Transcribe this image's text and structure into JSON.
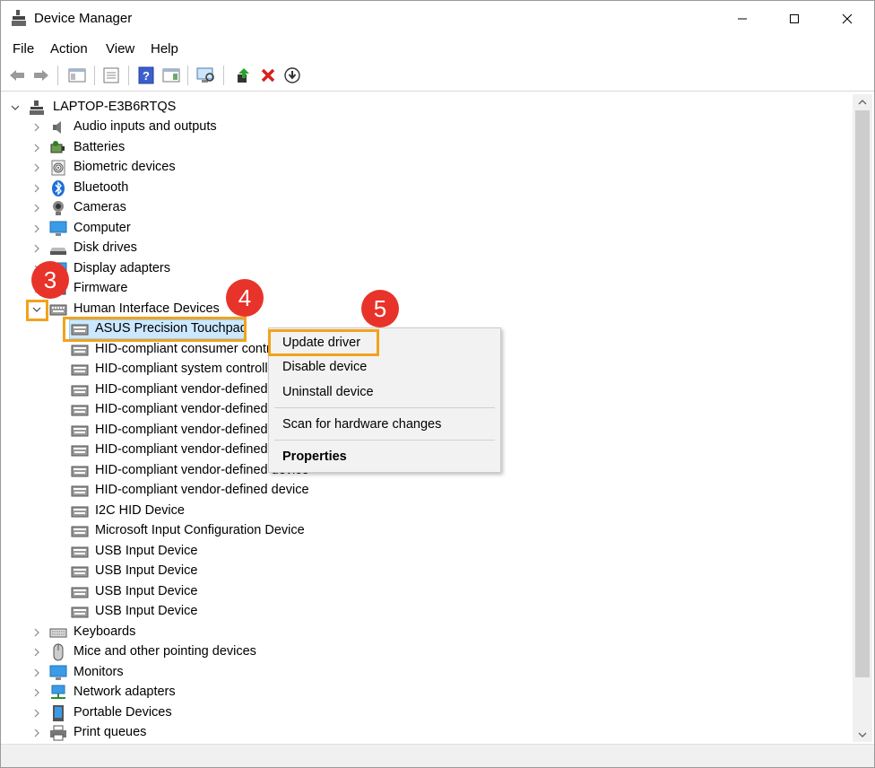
{
  "window": {
    "title": "Device Manager",
    "controls": {
      "minimize": "minimize",
      "maximize": "maximize",
      "close": "close"
    }
  },
  "menu": [
    "File",
    "Action",
    "View",
    "Help"
  ],
  "toolbar": {
    "buttons": [
      "back-icon",
      "forward-icon",
      "show-hide-console-tree-icon",
      "properties-icon",
      "help-icon",
      "action-pane-icon",
      "scan-hardware-icon",
      "update-driver-icon",
      "uninstall-icon",
      "rollback-icon"
    ]
  },
  "tree": {
    "root": "LAPTOP-E3B6RTQS",
    "categories_top": [
      {
        "label": "Audio inputs and outputs",
        "icon": "speaker-icon"
      },
      {
        "label": "Batteries",
        "icon": "battery-icon"
      },
      {
        "label": "Biometric devices",
        "icon": "fingerprint-icon"
      },
      {
        "label": "Bluetooth",
        "icon": "bluetooth-icon"
      },
      {
        "label": "Cameras",
        "icon": "camera-icon"
      },
      {
        "label": "Computer",
        "icon": "monitor-icon"
      },
      {
        "label": "Disk drives",
        "icon": "disk-icon"
      },
      {
        "label": "Display adapters",
        "icon": "display-adapter-icon"
      },
      {
        "label": "Firmware",
        "icon": "firmware-icon"
      },
      {
        "label": "Human Interface Devices",
        "icon": "hid-icon"
      }
    ],
    "hid_children": [
      "ASUS Precision Touchpad",
      "HID-compliant consumer control device",
      "HID-compliant system controller",
      "HID-compliant vendor-defined device",
      "HID-compliant vendor-defined device",
      "HID-compliant vendor-defined device",
      "HID-compliant vendor-defined device",
      "HID-compliant vendor-defined device",
      "HID-compliant vendor-defined device",
      "I2C HID Device",
      "Microsoft Input Configuration Device",
      "USB Input Device",
      "USB Input Device",
      "USB Input Device",
      "USB Input Device"
    ],
    "categories_bottom": [
      {
        "label": "Keyboards",
        "icon": "keyboard-icon"
      },
      {
        "label": "Mice and other pointing devices",
        "icon": "mouse-icon"
      },
      {
        "label": "Monitors",
        "icon": "monitor-icon"
      },
      {
        "label": "Network adapters",
        "icon": "network-icon"
      },
      {
        "label": "Portable Devices",
        "icon": "portable-device-icon"
      },
      {
        "label": "Print queues",
        "icon": "printer-icon"
      }
    ]
  },
  "context_menu": {
    "items": [
      "Update driver",
      "Disable device",
      "Uninstall device",
      "Scan for hardware changes",
      "Properties"
    ]
  },
  "annotations": {
    "step3": "3",
    "step4": "4",
    "step5": "5"
  },
  "colors": {
    "selection": "#cce8ff",
    "highlight": "#f2a21c",
    "step_badge": "#e8332a"
  }
}
